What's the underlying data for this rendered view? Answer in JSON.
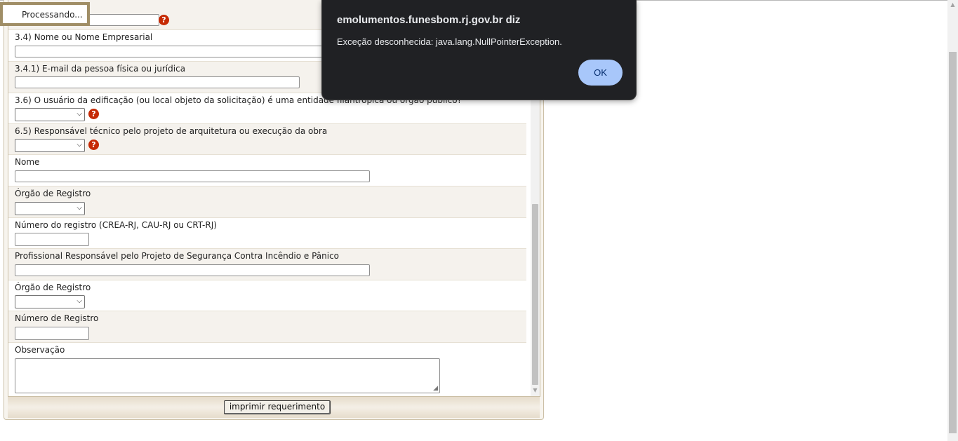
{
  "form": {
    "field_nome_empresarial": "3.4) Nome ou Nome Empresarial",
    "field_email": "3.4.1) E-mail da pessoa física ou jurídica",
    "field_usuario_entidade": "3.6) O usuário da edificação (ou local objeto da solicitação) é uma entidade filantrópica ou órgão público?",
    "field_responsavel_tecnico": "6.5) Responsável técnico pelo projeto de arquitetura ou execução da obra",
    "field_nome": "Nome",
    "field_orgao_registro": "Órgão de Registro",
    "field_numero_registro_crea": "Número do registro (CREA-RJ, CAU-RJ ou CRT-RJ)",
    "field_profissional_seguranca": "Profissional Responsável pelo Projeto de Segurança Contra Incêndio e Pânico",
    "field_orgao_registro_2": "Órgão de Registro",
    "field_numero_registro": "Número de Registro",
    "field_observacao": "Observação",
    "help_glyph": "?",
    "print_button": "imprimir requerimento"
  },
  "processing": {
    "label": "Processando..."
  },
  "alert": {
    "title": "emolumentos.funesbom.rj.gov.br diz",
    "message": "Exceção desconhecida: java.lang.NullPointerException.",
    "ok_label": "OK"
  },
  "colors": {
    "help_icon": "#c62a05",
    "dialog_bg": "#202124",
    "ok_button": "#a8c7fa",
    "processing_border": "#a08e66"
  }
}
